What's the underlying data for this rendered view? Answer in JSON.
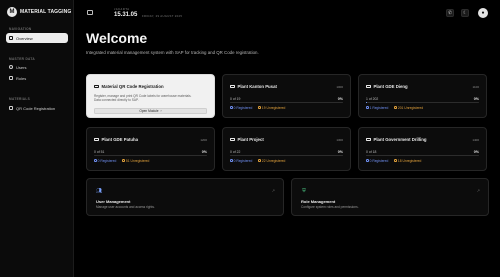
{
  "app": {
    "logo_letter": "M",
    "name": "MATERIAL TAGGING"
  },
  "sidebar": {
    "section_navigation": "NAVIGATION",
    "section_master": "MASTER DATA",
    "section_materials": "MATERIALS",
    "items": [
      {
        "label": "Overview",
        "icon": "grid-icon",
        "active": true
      },
      {
        "label": "Users",
        "icon": "users-icon"
      },
      {
        "label": "Roles",
        "icon": "shield-icon"
      },
      {
        "label": "QR Code Registration",
        "icon": "qr-icon"
      }
    ]
  },
  "header": {
    "clock_label": "JAKARTA",
    "time": "15.31.05",
    "date": "FRIDAY, 29 AUGUST 2025"
  },
  "page": {
    "title": "Welcome",
    "subtitle": "Integrated material management system with SAP for tracking and QR Code registration."
  },
  "qr_card": {
    "title": "Material QR Code Registration",
    "description": "Register, manage and print QR Code labels for warehouse materials. Data connected directly to SAP.",
    "button": "Open Module"
  },
  "plants": [
    {
      "name": "Plant Kanton Pusat",
      "code": "1000",
      "progress": "0 of 19",
      "pct": "0%",
      "fill": 0,
      "registered": "0 Registered",
      "unregistered": "19 Unregistered"
    },
    {
      "name": "Plant GDE Dieng",
      "code": "1100",
      "progress": "1 of 202",
      "pct": "0%",
      "fill": 0.5,
      "registered": "1 Registered",
      "unregistered": "201 Unregistered"
    },
    {
      "name": "Plant GDE Patuha",
      "code": "1200",
      "progress": "0 of 51",
      "pct": "0%",
      "fill": 0,
      "registered": "0 Registered",
      "unregistered": "51 Unregistered"
    },
    {
      "name": "Plant Project",
      "code": "1300",
      "progress": "0 of 22",
      "pct": "0%",
      "fill": 0,
      "registered": "0 Registered",
      "unregistered": "22 Unregistered"
    },
    {
      "name": "Plant Government Drilling",
      "code": "1400",
      "progress": "0 of 18",
      "pct": "0%",
      "fill": 0,
      "registered": "0 Registered",
      "unregistered": "18 Unregistered"
    }
  ],
  "management": [
    {
      "title": "User Management",
      "description": "Manage user accounts and access rights.",
      "icon": "users-icon",
      "color": "#7aa2ff"
    },
    {
      "title": "Role Management",
      "description": "Configure system roles and permissions.",
      "icon": "shield-icon",
      "color": "#4fd18b"
    }
  ],
  "colors": {
    "registered": "#6f8ff0",
    "unregistered": "#e0a03b",
    "accent_bar": "#7aa2ff"
  }
}
